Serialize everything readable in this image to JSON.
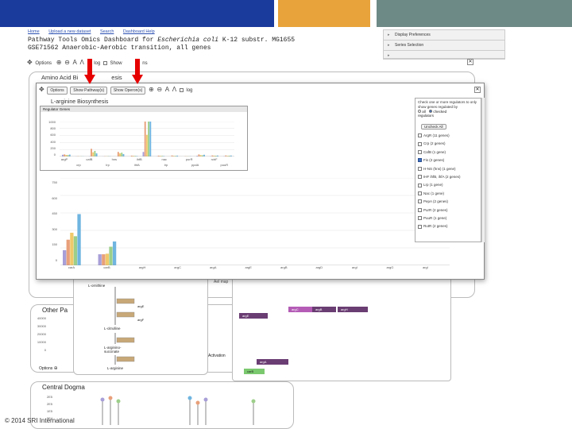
{
  "header_bars": {
    "colors": [
      "#1a3a9c",
      "#e8a33a",
      "#6e8a86"
    ]
  },
  "nav": {
    "items": [
      "Home",
      "Upload a new dataset",
      "Search",
      "Dashboard Help"
    ]
  },
  "title": {
    "line1_prefix": "Pathway Tools Omics Dashboard for ",
    "line1_organism": "Escherichia coli",
    "line1_suffix": " K-12 substr. MG1655",
    "line2": "GSE71562 Anaerobic-Aerobic transition, all genes"
  },
  "right_panel": {
    "items": [
      "Display Preferences",
      "Series Selection"
    ]
  },
  "outer_toolbar": {
    "options": "Options",
    "log": "log",
    "show_partial": "Show",
    "show_suffix": "ns"
  },
  "amino_acid_panel": {
    "title_partial": "Amino Acid Bi",
    "title_tail": "esis"
  },
  "popup": {
    "options": "Options",
    "show_pathways": "Show Pathway(s)",
    "show_operons": "Show Operon(s)",
    "log": "log",
    "subtitle": "L-arginine Biosynthesis",
    "inner_title": "Regulator Genes",
    "inner_yticks": [
      "1000",
      "800",
      "600",
      "400",
      "200",
      "0"
    ],
    "inner_xticks_top": [
      "argP",
      "cafB",
      "hns",
      "ihfB",
      "nac",
      "purR",
      "rcbF"
    ],
    "inner_xticks_bottom": [
      "crp",
      "lrp",
      "ihfA",
      "lrp",
      "ppdA",
      "puuR"
    ],
    "yticks": [
      "750",
      "600",
      "450",
      "300",
      "150",
      "0"
    ],
    "xticks": [
      "carA",
      "carB",
      "argH",
      "argC",
      "argA",
      "argE",
      "argB",
      "argD",
      "argI",
      "argG",
      "argI"
    ]
  },
  "chart_data": [
    {
      "type": "bar",
      "title": "Regulator Genes",
      "categories": [
        "argP",
        "crp",
        "cafB",
        "lrp",
        "hns",
        "ihfA",
        "ihfB",
        "lrp",
        "nac",
        "ppdA",
        "purR",
        "puuR",
        "rcbF"
      ],
      "series": [
        {
          "values": [
            50,
            5,
            10,
            5,
            0,
            0,
            130,
            5,
            0,
            0,
            20,
            10,
            10
          ],
          "color": "#a89fd8"
        },
        {
          "values": [
            60,
            10,
            220,
            10,
            130,
            25,
            1080,
            25,
            30,
            10,
            60,
            30,
            30
          ],
          "color": "#e8a07a"
        },
        {
          "values": [
            45,
            5,
            120,
            8,
            90,
            20,
            620,
            20,
            20,
            8,
            40,
            25,
            20
          ],
          "color": "#f1c96a"
        },
        {
          "values": [
            40,
            8,
            160,
            12,
            110,
            18,
            1090,
            18,
            18,
            6,
            35,
            22,
            24
          ],
          "color": "#9dcf8a"
        },
        {
          "values": [
            55,
            6,
            90,
            9,
            70,
            15,
            1010,
            15,
            25,
            7,
            50,
            28,
            28
          ],
          "color": "#6fb5e0"
        }
      ],
      "ylim": [
        0,
        1000
      ]
    },
    {
      "type": "bar",
      "title": "L-arginine Biosynthesis",
      "categories": [
        "carA",
        "carB",
        "argH",
        "argC",
        "argA",
        "argE",
        "argB",
        "argD",
        "argI",
        "argG",
        "argI"
      ],
      "series": [
        {
          "values": [
            130,
            95,
            0,
            0,
            0,
            0,
            0,
            0,
            0,
            0,
            0
          ],
          "color": "#a89fd8"
        },
        {
          "values": [
            220,
            95,
            0,
            0,
            0,
            0,
            0,
            0,
            0,
            0,
            0
          ],
          "color": "#e8a07a"
        },
        {
          "values": [
            280,
            100,
            0,
            0,
            0,
            0,
            0,
            0,
            0,
            0,
            0
          ],
          "color": "#f1c96a"
        },
        {
          "values": [
            250,
            160,
            0,
            0,
            0,
            0,
            0,
            0,
            0,
            0,
            0
          ],
          "color": "#9dcf8a"
        },
        {
          "values": [
            440,
            205,
            0,
            0,
            0,
            0,
            0,
            0,
            0,
            0,
            0
          ],
          "color": "#6fb5e0"
        }
      ],
      "ylim": [
        0,
        750
      ]
    }
  ],
  "filter_panel": {
    "intro": "Check one or more regulators to only show genes regulated by",
    "all_label": "all",
    "checked_label": "checked",
    "regulators_label": "regulators",
    "uncheck_all": "Uncheck All",
    "items": [
      {
        "label": "ArgR (11 genes)",
        "checked": false
      },
      {
        "label": "Crp (2 genes)",
        "checked": false
      },
      {
        "label": "CafB (1 gene)",
        "checked": false
      },
      {
        "label": "Fis (2 genes)",
        "checked": true
      },
      {
        "label": "H-NS (hns) (1 gene)",
        "checked": false
      },
      {
        "label": "IHF ihfB, ihfA (2 genes)",
        "checked": false
      },
      {
        "label": "Lrp (1 gene)",
        "checked": false
      },
      {
        "label": "Nac (1 gene)",
        "checked": false
      },
      {
        "label": "PepA (2 genes)",
        "checked": false
      },
      {
        "label": "PurR (2 genes)",
        "checked": false
      },
      {
        "label": "PuuR (1 gene)",
        "checked": false
      },
      {
        "label": "RutR (2 genes)",
        "checked": false
      }
    ]
  },
  "other_panel": {
    "title": "Other Pa",
    "yticks": [
      "40000",
      "30000",
      "20000",
      "10000",
      "0"
    ],
    "options": "Options"
  },
  "central_dogma": {
    "title": "Central Dogma",
    "yticks": [
      "2E5",
      "2E5",
      "1E5",
      "5E4",
      "0"
    ]
  },
  "pathway_view": {
    "nodes": [
      "L-ornithine",
      "L-citrulline",
      "L-arginino-succinate",
      "L-arginine"
    ],
    "genes": [
      "argE",
      "argF",
      "argG",
      "argH"
    ]
  },
  "operon_view": {
    "heading": "Ael map",
    "genes_top": [
      "argB",
      "argC",
      "argH"
    ],
    "genes_bottom": [
      "argE",
      "argA"
    ],
    "genes_small": [
      "carB"
    ]
  },
  "activation_label": "Activation",
  "footer": {
    "copyright": "© 2014 SRI International"
  }
}
